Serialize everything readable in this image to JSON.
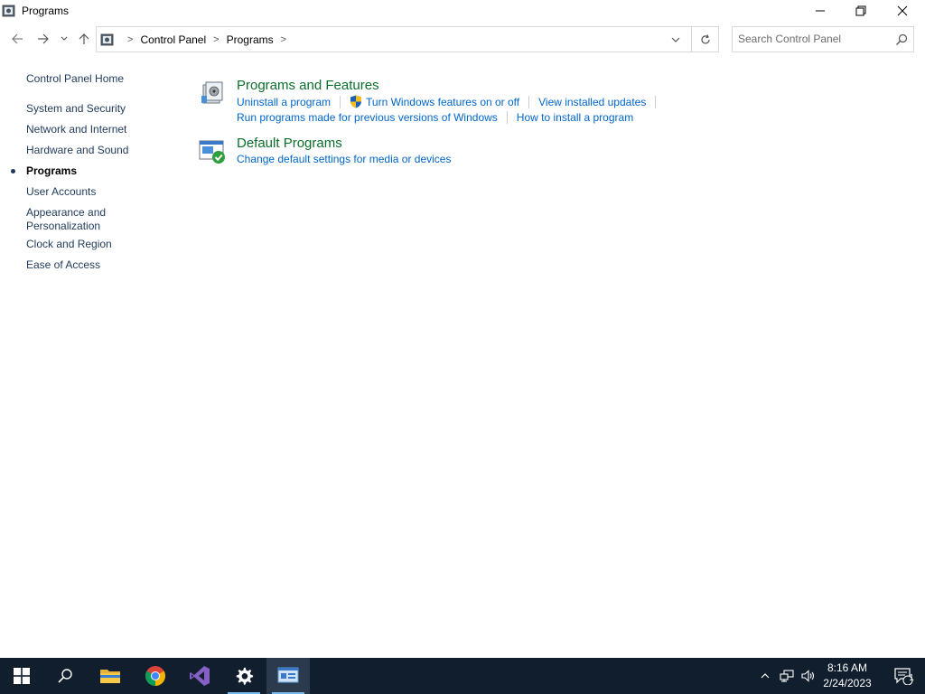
{
  "window": {
    "title": "Programs"
  },
  "nav": {
    "breadcrumbs": [
      "Control Panel",
      "Programs"
    ],
    "search_placeholder": "Search Control Panel"
  },
  "sidebar": {
    "items": [
      {
        "label": "Control Panel Home",
        "active": false
      },
      {
        "label": "System and Security",
        "active": false
      },
      {
        "label": "Network and Internet",
        "active": false
      },
      {
        "label": "Hardware and Sound",
        "active": false
      },
      {
        "label": "Programs",
        "active": true
      },
      {
        "label": "User Accounts",
        "active": false
      },
      {
        "label": "Appearance and",
        "label2": "Personalization",
        "active": false
      },
      {
        "label": "Clock and Region",
        "active": false
      },
      {
        "label": "Ease of Access",
        "active": false
      }
    ]
  },
  "main": {
    "sections": [
      {
        "title": "Programs and Features",
        "icon": "programs-features-icon",
        "tasks_row1": [
          "Uninstall a program",
          "Turn Windows features on or off",
          "View installed updates"
        ],
        "tasks_row2": [
          "Run programs made for previous versions of Windows",
          "How to install a program"
        ]
      },
      {
        "title": "Default Programs",
        "icon": "default-programs-icon",
        "tasks_row1": [
          "Change default settings for media or devices"
        ]
      }
    ]
  },
  "taskbar": {
    "apps": [
      "start-icon",
      "search-icon",
      "file-explorer-icon",
      "chrome-icon",
      "visual-studio-icon",
      "settings-icon",
      "control-panel-icon"
    ],
    "time": "8:16 AM",
    "date": "2/24/2023",
    "notification_count": "1"
  },
  "colors": {
    "link": "#0066cc",
    "section_title": "#0b6e2b",
    "sidebar_link": "#1e395b",
    "taskbar_bg": "#101e2e"
  }
}
